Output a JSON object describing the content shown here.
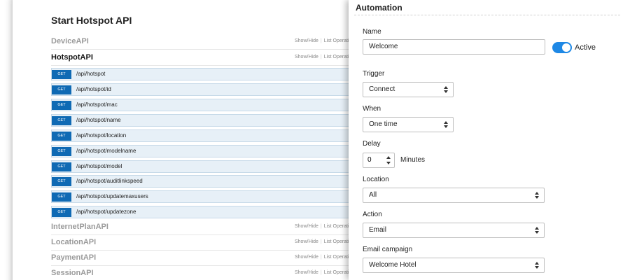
{
  "api_doc": {
    "title": "Start Hotspot API",
    "sections_top": [
      {
        "name": "DeviceAPI",
        "show_hide": "Show/Hide",
        "list_ops": "List Operations",
        "active": false
      },
      {
        "name": "HotspotAPI",
        "show_hide": "Show/Hide",
        "list_ops": "List Operations",
        "active": true
      }
    ],
    "operations": [
      {
        "method": "GET",
        "path": "/api/hotspot"
      },
      {
        "method": "GET",
        "path": "/api/hotspot/id"
      },
      {
        "method": "GET",
        "path": "/api/hotspot/mac"
      },
      {
        "method": "GET",
        "path": "/api/hotspot/name"
      },
      {
        "method": "GET",
        "path": "/api/hotspot/location"
      },
      {
        "method": "GET",
        "path": "/api/hotspot/modelname"
      },
      {
        "method": "GET",
        "path": "/api/hotspot/model"
      },
      {
        "method": "GET",
        "path": "/api/hotspot/auditlinkspeed"
      },
      {
        "method": "GET",
        "path": "/api/hotspot/updatemaxusers"
      },
      {
        "method": "GET",
        "path": "/api/hotspot/updatezone"
      }
    ],
    "sections_bottom": [
      {
        "name": "InternetPlanAPI",
        "show_hide": "Show/Hide",
        "list_ops": "List Operations"
      },
      {
        "name": "LocationAPI",
        "show_hide": "Show/Hide",
        "list_ops": "List Operations"
      },
      {
        "name": "PaymentAPI",
        "show_hide": "Show/Hide",
        "list_ops": "List Operations"
      },
      {
        "name": "SessionAPI",
        "show_hide": "Show/Hide",
        "list_ops": "List Operations"
      }
    ]
  },
  "automation": {
    "title": "Automation",
    "name_label": "Name",
    "name_value": "Welcome",
    "active_label": "Active",
    "active": true,
    "trigger_label": "Trigger",
    "trigger_value": "Connect",
    "when_label": "When",
    "when_value": "One time",
    "delay_label": "Delay",
    "delay_value": "0",
    "delay_unit": "Minutes",
    "location_label": "Location",
    "location_value": "All",
    "action_label": "Action",
    "action_value": "Email",
    "campaign_label": "Email campaign",
    "campaign_value": "Welcome Hotel",
    "accent_color": "#1e88e5"
  }
}
